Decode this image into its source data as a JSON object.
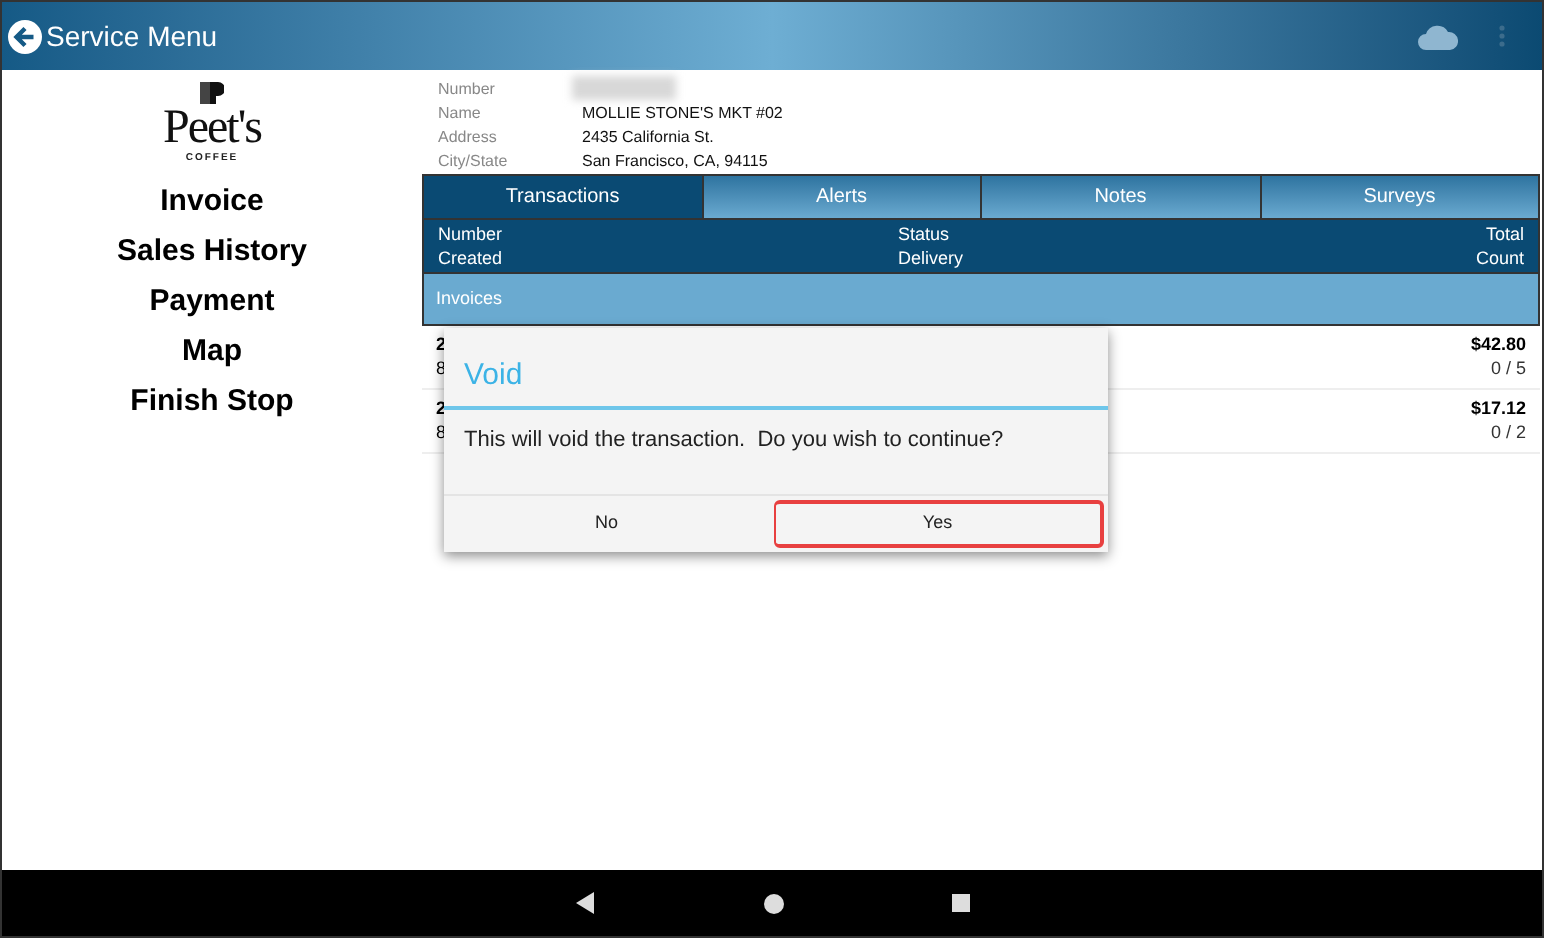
{
  "header": {
    "title": "Service Menu"
  },
  "logo": {
    "wordmark": "Peet's",
    "tagline": "COFFEE"
  },
  "menu": [
    "Invoice",
    "Sales History",
    "Payment",
    "Map",
    "Finish Stop"
  ],
  "customer": [
    {
      "label": "Number"
    },
    {
      "label": "Name",
      "value": "MOLLIE STONE'S MKT #02"
    },
    {
      "label": "Address",
      "value": "2435 California St."
    },
    {
      "label": "City/State",
      "value": "San Francisco, CA, 94115"
    }
  ],
  "tabs": [
    {
      "label": "Transactions",
      "selected": true
    },
    {
      "label": "Alerts",
      "selected": false
    },
    {
      "label": "Notes",
      "selected": false
    },
    {
      "label": "Surveys",
      "selected": false
    }
  ],
  "columns": {
    "left": [
      "Number",
      "Created"
    ],
    "middle": [
      "Status",
      "Delivery"
    ],
    "right": [
      "Total",
      "Count"
    ]
  },
  "group": "Invoices",
  "rows": [
    {
      "number": "2",
      "created": "8",
      "total": "$42.80",
      "count": "0 / 5"
    },
    {
      "number": "2",
      "created": "8",
      "total": "$17.12",
      "count": "0 / 2"
    }
  ],
  "dialog": {
    "title": "Void",
    "message": "This will void the transaction.  Do you wish to continue?",
    "buttons": [
      {
        "label": "No",
        "highlighted": false
      },
      {
        "label": "Yes",
        "highlighted": true
      }
    ]
  }
}
